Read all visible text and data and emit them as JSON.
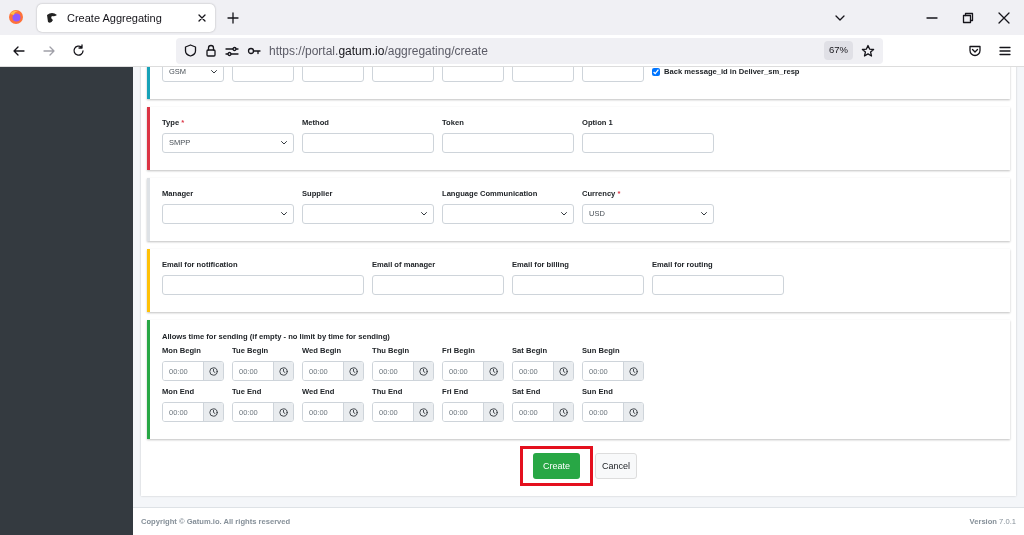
{
  "browser": {
    "tab": {
      "title": "Create Aggregating"
    },
    "url_parts": [
      {
        "kind": "plain",
        "text": "https://portal."
      },
      {
        "kind": "domain",
        "text": "gatum.io"
      },
      {
        "kind": "plain",
        "text": "/aggregating/create"
      }
    ],
    "zoom": "67%"
  },
  "sections": [
    {
      "color": "#17a2b8",
      "fields": [
        {
          "kind": "small-select",
          "value": "GSM"
        },
        {
          "kind": "small-input"
        },
        {
          "kind": "small-input"
        },
        {
          "kind": "small-input"
        },
        {
          "kind": "small-input"
        },
        {
          "kind": "small-input"
        },
        {
          "kind": "small-input"
        },
        {
          "kind": "checkbox",
          "label": "Back message_id in Deliver_sm_resp",
          "checked": true
        }
      ]
    },
    {
      "color": "#dc3545",
      "fields": [
        {
          "kind": "select",
          "label": "Type",
          "required_mark": "*",
          "value": "SMPP"
        },
        {
          "kind": "input",
          "label": "Method"
        },
        {
          "kind": "input",
          "label": "Token"
        },
        {
          "kind": "input",
          "label": "Option 1"
        }
      ]
    },
    {
      "color": "#dee2e6",
      "fields": [
        {
          "kind": "select",
          "label": "Manager"
        },
        {
          "kind": "select",
          "label": "Supplier"
        },
        {
          "kind": "select",
          "label": "Language Communication"
        },
        {
          "kind": "select",
          "label": "Currency",
          "required_mark": "*",
          "value": "USD"
        }
      ]
    },
    {
      "color": "#ffc107",
      "fields": [
        {
          "kind": "wide-input",
          "label": "Email for notification"
        },
        {
          "kind": "input",
          "label": "Email of manager"
        },
        {
          "kind": "input",
          "label": "Email for billing"
        },
        {
          "kind": "input",
          "label": "Email for routing"
        }
      ]
    },
    {
      "color": "#28a745",
      "title": "Allows time for sending (if empty - no limit by time for sending)",
      "fields": [
        {
          "kind": "time",
          "label": "Mon Begin",
          "placeholder": "00:00"
        },
        {
          "kind": "time",
          "label": "Tue Begin",
          "placeholder": "00:00"
        },
        {
          "kind": "time",
          "label": "Wed Begin",
          "placeholder": "00:00"
        },
        {
          "kind": "time",
          "label": "Thu Begin",
          "placeholder": "00:00"
        },
        {
          "kind": "time",
          "label": "Fri Begin",
          "placeholder": "00:00"
        },
        {
          "kind": "time",
          "label": "Sat Begin",
          "placeholder": "00:00"
        },
        {
          "kind": "time",
          "label": "Sun Begin",
          "placeholder": "00:00"
        },
        {
          "kind": "time",
          "label": "Mon End",
          "placeholder": "00:00"
        },
        {
          "kind": "time",
          "label": "Tue End",
          "placeholder": "00:00"
        },
        {
          "kind": "time",
          "label": "Wed End",
          "placeholder": "00:00"
        },
        {
          "kind": "time",
          "label": "Thu End",
          "placeholder": "00:00"
        },
        {
          "kind": "time",
          "label": "Fri End",
          "placeholder": "00:00"
        },
        {
          "kind": "time",
          "label": "Sat End",
          "placeholder": "00:00"
        },
        {
          "kind": "time",
          "label": "Sun End",
          "placeholder": "00:00"
        }
      ]
    }
  ],
  "actions": [
    {
      "kind": "primary",
      "label": "Create",
      "highlighted": true
    },
    {
      "kind": "secondary",
      "label": "Cancel",
      "highlighted": false
    }
  ],
  "footer": {
    "copyright": "Copyright © Gatum.io. All rights reserved",
    "version_label": "Version",
    "version": "7.0.1"
  }
}
